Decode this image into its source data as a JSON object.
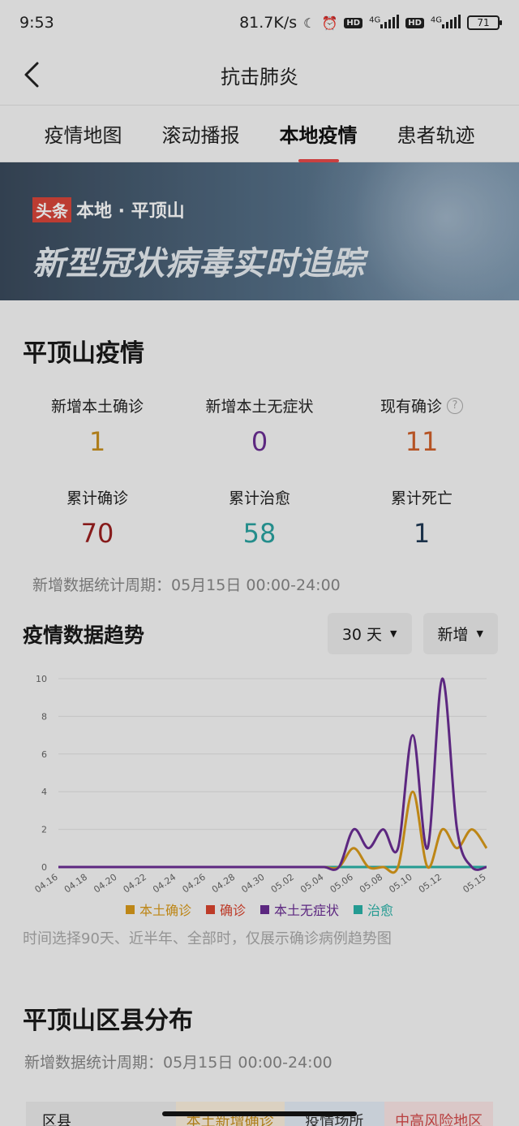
{
  "status_bar": {
    "time": "9:53",
    "net_speed": "81.7K/s",
    "network_1": "4G",
    "network_2": "4G",
    "battery": "71"
  },
  "navbar": {
    "title": "抗击肺炎"
  },
  "tabs": [
    {
      "label": "疫情地图"
    },
    {
      "label": "滚动播报"
    },
    {
      "label": "本地疫情",
      "active": true
    },
    {
      "label": "患者轨迹"
    }
  ],
  "banner": {
    "tag": "头条",
    "location": "本地 · 平顶山",
    "title": "新型冠状病毒实时追踪"
  },
  "epidemic": {
    "title": "平顶山疫情",
    "stats": [
      {
        "label": "新增本土确诊",
        "value": "1",
        "color": "#c8901e"
      },
      {
        "label": "新增本土无症状",
        "value": "0",
        "color": "#6a2d94"
      },
      {
        "label": "现有确诊",
        "value": "11",
        "color": "#d0602a",
        "help": "?"
      },
      {
        "label": "累计确诊",
        "value": "70",
        "color": "#9b2020"
      },
      {
        "label": "累计治愈",
        "value": "58",
        "color": "#2aa3a0"
      },
      {
        "label": "累计死亡",
        "value": "1",
        "color": "#213a55"
      }
    ],
    "period": "新增数据统计周期：05月15日 00:00-24:00"
  },
  "trend": {
    "title": "疫情数据趋势",
    "range_select": "30 天",
    "type_select": "新增",
    "note": "时间选择90天、近半年、全部时，仅展示确诊病例趋势图"
  },
  "chart_data": {
    "type": "line",
    "x_tick_labels": [
      "04.16",
      "04.18",
      "04.20",
      "04.22",
      "04.24",
      "04.26",
      "04.28",
      "04.30",
      "05.02",
      "05.04",
      "05.06",
      "05.08",
      "05.10",
      "05.12",
      "05.15"
    ],
    "x": [
      "04.16",
      "04.17",
      "04.18",
      "04.19",
      "04.20",
      "04.21",
      "04.22",
      "04.23",
      "04.24",
      "04.25",
      "04.26",
      "04.27",
      "04.28",
      "04.29",
      "04.30",
      "05.01",
      "05.02",
      "05.03",
      "05.04",
      "05.05",
      "05.06",
      "05.07",
      "05.08",
      "05.09",
      "05.10",
      "05.11",
      "05.12",
      "05.13",
      "05.14",
      "05.15"
    ],
    "ylim": [
      0,
      10
    ],
    "y_ticks": [
      0,
      2,
      4,
      6,
      8,
      10
    ],
    "grid": true,
    "legend_position": "bottom",
    "series": [
      {
        "name": "本土确诊",
        "color": "#d99a1a",
        "values": [
          0,
          0,
          0,
          0,
          0,
          0,
          0,
          0,
          0,
          0,
          0,
          0,
          0,
          0,
          0,
          0,
          0,
          0,
          0,
          0,
          1,
          0,
          0,
          0,
          4,
          0,
          2,
          1,
          2,
          1
        ]
      },
      {
        "name": "确诊",
        "color": "#d9442f",
        "values": []
      },
      {
        "name": "本土无症状",
        "color": "#6a2d94",
        "values": [
          0,
          0,
          0,
          0,
          0,
          0,
          0,
          0,
          0,
          0,
          0,
          0,
          0,
          0,
          0,
          0,
          0,
          0,
          0,
          0,
          2,
          1,
          2,
          1,
          7,
          1,
          10,
          2,
          0,
          0
        ]
      },
      {
        "name": "治愈",
        "color": "#2ab3a8",
        "values": [
          0,
          0,
          0,
          0,
          0,
          0,
          0,
          0,
          0,
          0,
          0,
          0,
          0,
          0,
          0,
          0,
          0,
          0,
          0,
          0,
          0,
          0,
          0,
          0,
          0,
          0,
          0,
          0,
          0,
          0
        ]
      }
    ]
  },
  "district": {
    "title": "平顶山区县分布",
    "period": "新增数据统计周期：05月15日 00:00-24:00",
    "columns": [
      "区县",
      "本土新增确诊",
      "疫情场所",
      "中高风险地区"
    ]
  }
}
